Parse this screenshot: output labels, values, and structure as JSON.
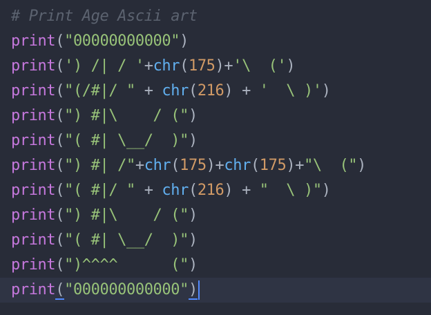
{
  "editor": {
    "comment": "# Print Age Ascii art",
    "lines": [
      {
        "segments": [
          {
            "t": "print",
            "c": "kw"
          },
          {
            "t": "(",
            "c": "paren"
          },
          {
            "t": "\"00000000000\"",
            "c": "str"
          },
          {
            "t": ")",
            "c": "paren"
          }
        ]
      },
      {
        "segments": [
          {
            "t": "print",
            "c": "kw"
          },
          {
            "t": "(",
            "c": "paren"
          },
          {
            "t": "') /| / '",
            "c": "str"
          },
          {
            "t": "+",
            "c": "op"
          },
          {
            "t": "chr",
            "c": "fn"
          },
          {
            "t": "(",
            "c": "paren"
          },
          {
            "t": "175",
            "c": "num"
          },
          {
            "t": ")",
            "c": "paren"
          },
          {
            "t": "+",
            "c": "op"
          },
          {
            "t": "'\\  ('",
            "c": "str"
          },
          {
            "t": ")",
            "c": "paren"
          }
        ]
      },
      {
        "segments": [
          {
            "t": "print",
            "c": "kw"
          },
          {
            "t": "(",
            "c": "paren"
          },
          {
            "t": "\"(/#|/ \"",
            "c": "str"
          },
          {
            "t": " + ",
            "c": "op"
          },
          {
            "t": "chr",
            "c": "fn"
          },
          {
            "t": "(",
            "c": "paren"
          },
          {
            "t": "216",
            "c": "num"
          },
          {
            "t": ")",
            "c": "paren"
          },
          {
            "t": " + ",
            "c": "op"
          },
          {
            "t": "'  \\ )'",
            "c": "str"
          },
          {
            "t": ")",
            "c": "paren"
          }
        ]
      },
      {
        "segments": [
          {
            "t": "print",
            "c": "kw"
          },
          {
            "t": "(",
            "c": "paren"
          },
          {
            "t": "\") #|\\    / (\"",
            "c": "str"
          },
          {
            "t": ")",
            "c": "paren"
          }
        ]
      },
      {
        "segments": [
          {
            "t": "print",
            "c": "kw"
          },
          {
            "t": "(",
            "c": "paren"
          },
          {
            "t": "\"( #| \\__/  )\"",
            "c": "str"
          },
          {
            "t": ")",
            "c": "paren"
          }
        ]
      },
      {
        "segments": [
          {
            "t": "print",
            "c": "kw"
          },
          {
            "t": "(",
            "c": "paren"
          },
          {
            "t": "\") #| /\"",
            "c": "str"
          },
          {
            "t": "+",
            "c": "op"
          },
          {
            "t": "chr",
            "c": "fn"
          },
          {
            "t": "(",
            "c": "paren"
          },
          {
            "t": "175",
            "c": "num"
          },
          {
            "t": ")",
            "c": "paren"
          },
          {
            "t": "+",
            "c": "op"
          },
          {
            "t": "chr",
            "c": "fn"
          },
          {
            "t": "(",
            "c": "paren"
          },
          {
            "t": "175",
            "c": "num"
          },
          {
            "t": ")",
            "c": "paren"
          },
          {
            "t": "+",
            "c": "op"
          },
          {
            "t": "\"\\  (\"",
            "c": "str"
          },
          {
            "t": ")",
            "c": "paren"
          }
        ]
      },
      {
        "segments": [
          {
            "t": "print",
            "c": "kw"
          },
          {
            "t": "(",
            "c": "paren"
          },
          {
            "t": "\"( #|/ \"",
            "c": "str"
          },
          {
            "t": " + ",
            "c": "op"
          },
          {
            "t": "chr",
            "c": "fn"
          },
          {
            "t": "(",
            "c": "paren"
          },
          {
            "t": "216",
            "c": "num"
          },
          {
            "t": ")",
            "c": "paren"
          },
          {
            "t": " + ",
            "c": "op"
          },
          {
            "t": "\"  \\ )\"",
            "c": "str"
          },
          {
            "t": ")",
            "c": "paren"
          }
        ]
      },
      {
        "segments": [
          {
            "t": "print",
            "c": "kw"
          },
          {
            "t": "(",
            "c": "paren"
          },
          {
            "t": "\") #|\\    / (\"",
            "c": "str"
          },
          {
            "t": ")",
            "c": "paren"
          }
        ]
      },
      {
        "segments": [
          {
            "t": "print",
            "c": "kw"
          },
          {
            "t": "(",
            "c": "paren"
          },
          {
            "t": "\"( #| \\__/  )\"",
            "c": "str"
          },
          {
            "t": ")",
            "c": "paren"
          }
        ]
      },
      {
        "segments": [
          {
            "t": "print",
            "c": "kw"
          },
          {
            "t": "(",
            "c": "paren"
          },
          {
            "t": "\")^^^^      (\"",
            "c": "str"
          },
          {
            "t": ")",
            "c": "paren"
          }
        ]
      },
      {
        "current": true,
        "segments": [
          {
            "t": "print",
            "c": "kw"
          },
          {
            "t": "(",
            "c": "paren match"
          },
          {
            "t": "\"000000000000\"",
            "c": "str"
          },
          {
            "t": ")",
            "c": "paren match"
          }
        ]
      }
    ]
  },
  "colors": {
    "background": "#282c38",
    "keyword": "#c678dd",
    "string": "#98c379",
    "function": "#61afef",
    "number": "#d19a66",
    "comment": "#5c6370",
    "cursor": "#528bff"
  }
}
